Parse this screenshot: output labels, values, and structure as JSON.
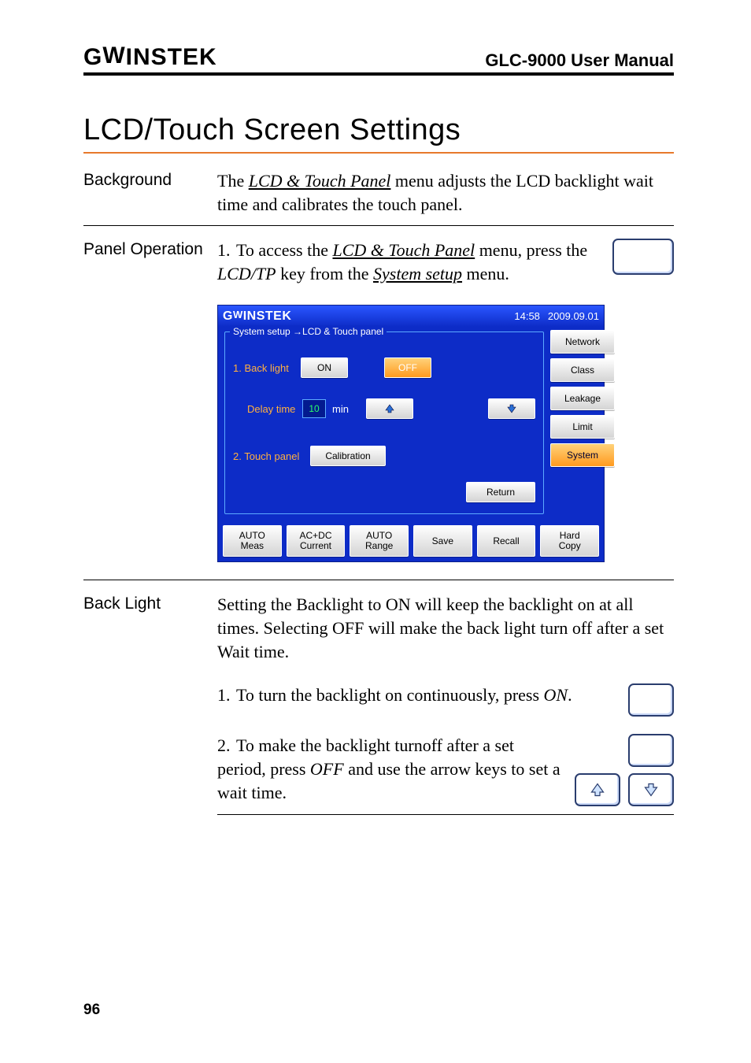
{
  "header": {
    "logo": "GWINSTEK",
    "manual": "GLC-9000 User Manual"
  },
  "title": "LCD/Touch Screen Settings",
  "background": {
    "label": "Background",
    "text_before": "The ",
    "link": "LCD & Touch Panel",
    "text_after": " menu adjusts the LCD backlight wait time and calibrates the touch panel."
  },
  "panel_op": {
    "label": "Panel Operation",
    "num": "1.",
    "t1": "To access the ",
    "link1": "LCD & Touch Panel",
    "t2": " menu, press the ",
    "ital1": "LCD/TP",
    "t3": " key from the ",
    "link2": "System setup",
    "t4": " menu."
  },
  "device": {
    "brand": "GWINSTEK",
    "time": "14:58",
    "date": "2009.09.01",
    "breadcrumb": "System setup →LCD & Touch panel",
    "row1_label": "1. Back light",
    "btn_on": "ON",
    "btn_off": "OFF",
    "row2_label": "Delay time",
    "delay_val": "10",
    "delay_unit": "min",
    "row3_label": "2. Touch panel",
    "btn_cal": "Calibration",
    "btn_return": "Return",
    "side": [
      "Network",
      "Class",
      "Leakage",
      "Limit",
      "System"
    ],
    "bottom": [
      [
        "AUTO",
        "Meas"
      ],
      [
        "AC+DC",
        "Current"
      ],
      [
        "AUTO",
        "Range"
      ],
      [
        "Save",
        ""
      ],
      [
        "Recall",
        ""
      ],
      [
        "Hard",
        "Copy"
      ]
    ]
  },
  "backlight": {
    "label": "Back Light",
    "intro": "Setting the Backlight to ON will keep the backlight on at all times. Selecting OFF will make the back light turn off after a set Wait time.",
    "s1_num": "1.",
    "s1_t1": "To turn the backlight on continuously, press ",
    "s1_ital": "ON",
    "s1_t2": ".",
    "s2_num": "2.",
    "s2_t1": "To make the backlight turnoff after a set period, press ",
    "s2_ital": "OFF",
    "s2_t2": " and use the arrow keys to set a wait time."
  },
  "pagenum": "96"
}
